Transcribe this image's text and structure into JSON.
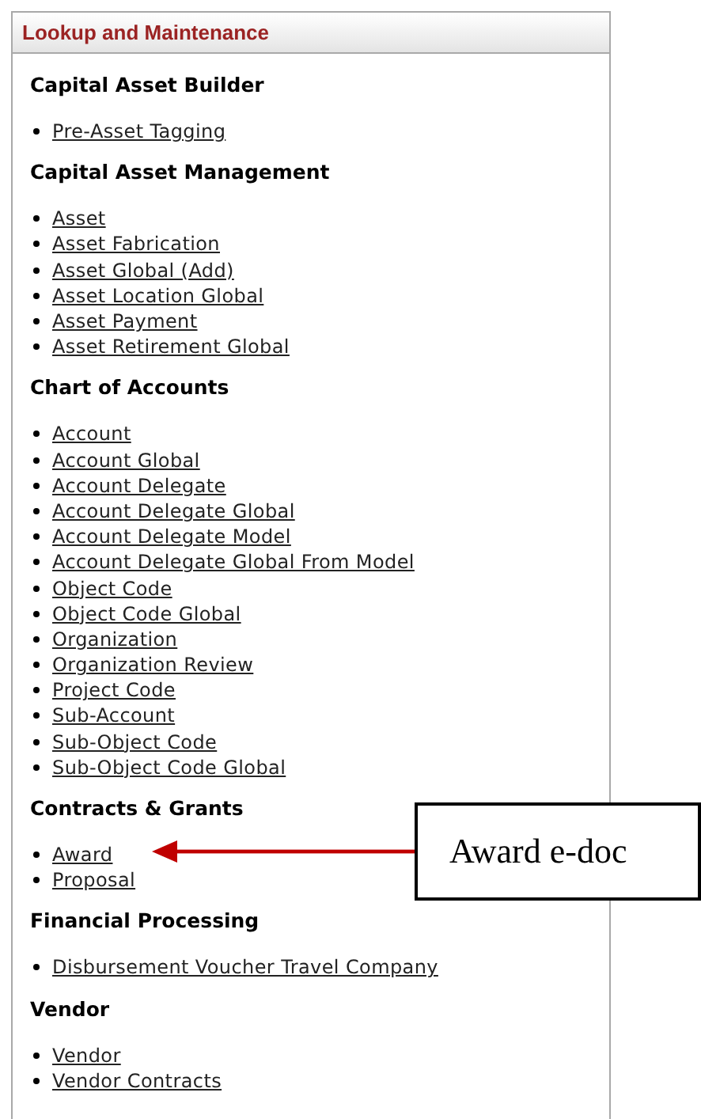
{
  "panel": {
    "title": "Lookup and Maintenance"
  },
  "sections": [
    {
      "heading": "Capital Asset Builder",
      "items": [
        "Pre-Asset Tagging"
      ]
    },
    {
      "heading": "Capital Asset Management",
      "items": [
        "Asset",
        "Asset Fabrication",
        "Asset Global (Add)",
        "Asset Location Global",
        "Asset Payment",
        "Asset Retirement Global"
      ]
    },
    {
      "heading": "Chart of Accounts",
      "items": [
        "Account",
        "Account Global",
        "Account Delegate",
        "Account Delegate Global",
        "Account Delegate Model",
        "Account Delegate Global From Model",
        "Object Code",
        "Object Code Global",
        "Organization",
        "Organization Review",
        "Project Code",
        "Sub-Account",
        "Sub-Object Code",
        "Sub-Object Code Global"
      ]
    },
    {
      "heading": "Contracts & Grants",
      "items": [
        "Award",
        "Proposal"
      ]
    },
    {
      "heading": "Financial Processing",
      "items": [
        "Disbursement Voucher Travel Company"
      ]
    },
    {
      "heading": "Vendor",
      "items": [
        "Vendor",
        "Vendor Contracts"
      ]
    }
  ],
  "callout": {
    "text": "Award e-doc"
  }
}
